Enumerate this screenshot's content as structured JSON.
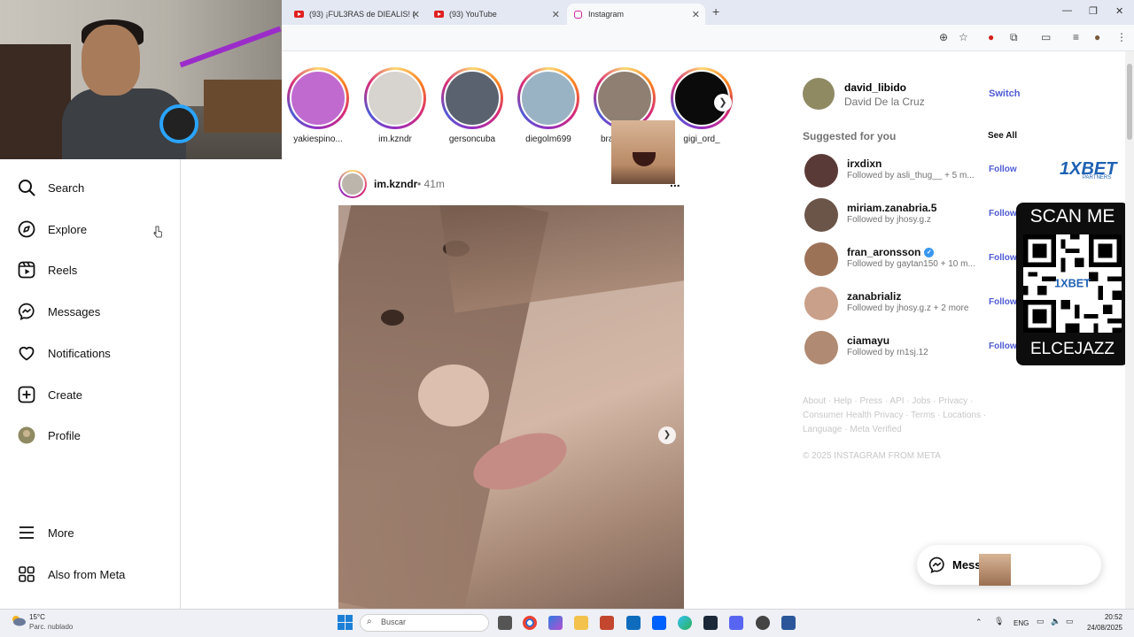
{
  "browser": {
    "tabs": [
      {
        "label": "(93) ¡FUL3RAS de DIEALIS! (",
        "type": "youtube"
      },
      {
        "label": "(93) YouTube",
        "type": "youtube"
      },
      {
        "label": "Instagram",
        "type": "instagram",
        "active": true
      }
    ],
    "new_tab": "+"
  },
  "sidebar": {
    "items": [
      {
        "label": "Search",
        "icon": "search-icon"
      },
      {
        "label": "Explore",
        "icon": "compass-icon"
      },
      {
        "label": "Reels",
        "icon": "reels-icon"
      },
      {
        "label": "Messages",
        "icon": "messenger-icon"
      },
      {
        "label": "Notifications",
        "icon": "heart-icon"
      },
      {
        "label": "Create",
        "icon": "plus-square-icon"
      },
      {
        "label": "Profile",
        "icon": "avatar"
      }
    ],
    "more_label": "More",
    "meta_label": "Also from Meta"
  },
  "stories": [
    {
      "username": "yakiespino...",
      "color": "#c06ad0"
    },
    {
      "username": "im.kzndr",
      "color": "#d7d3ce"
    },
    {
      "username": "gersoncuba",
      "color": "#5a6270"
    },
    {
      "username": "diegolm699",
      "color": "#9ab3c4"
    },
    {
      "username": "bra",
      "color": "#8e7f72"
    },
    {
      "username": "gigi_ord_",
      "color": "#0b0b0b"
    }
  ],
  "post": {
    "username": "im.kzndr",
    "time": "• 41m",
    "more": "..."
  },
  "account": {
    "username": "david_libido",
    "full_name": "David De la Cruz",
    "switch_label": "Switch"
  },
  "suggested": {
    "title": "Suggested for you",
    "see_all": "See All",
    "items": [
      {
        "username": "irxdixn",
        "followed_by": "Followed by asli_thug__ + 5 m...",
        "follow": "Follow",
        "verified": false,
        "color": "#5a3a36"
      },
      {
        "username": "miriam.zanabria.5",
        "followed_by": "Followed by jhosy.g.z",
        "follow": "Follow",
        "verified": false,
        "color": "#6b5448"
      },
      {
        "username": "fran_aronsson",
        "followed_by": "Followed by gaytan150 + 10 m...",
        "follow": "Follow",
        "verified": true,
        "color": "#9c7257"
      },
      {
        "username": "zanabrializ",
        "followed_by": "Followed by jhosy.g.z + 2 more",
        "follow": "Follow",
        "verified": false,
        "color": "#c9a08a"
      },
      {
        "username": "ciamayu",
        "followed_by": "Followed by rn1sj.12",
        "follow": "Follow",
        "verified": false,
        "color": "#b08a72"
      }
    ]
  },
  "footer": {
    "links": "About · Help · Press · API · Jobs · Privacy · Consumer Health Privacy · Terms · Locations · Language · Meta Verified",
    "copyright": "© 2025 INSTAGRAM FROM META"
  },
  "ads": {
    "brand": "1XBET",
    "partners": "PARTNERS",
    "scan_me": "SCAN ME",
    "code": "ELCEJAZZ"
  },
  "messages_pill": {
    "label": "Mess"
  },
  "taskbar": {
    "weather_temp": "15°C",
    "weather_desc": "Parc. nublado",
    "search_placeholder": "Buscar",
    "lang": "ENG",
    "time": "20:52",
    "date": "24/08/2025"
  },
  "colors": {
    "accent": "#4f5bd5",
    "youtube": "#e02020"
  }
}
